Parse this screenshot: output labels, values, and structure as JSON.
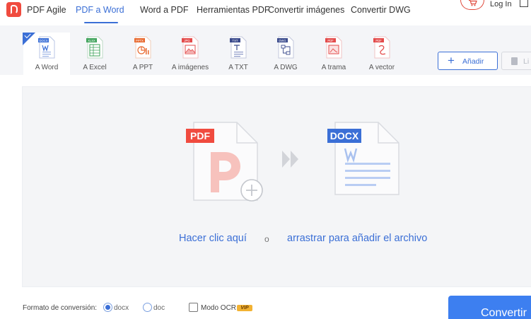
{
  "nav": {
    "items": [
      {
        "label": "PDF Agile",
        "active": false
      },
      {
        "label": "PDF a Word",
        "active": true
      },
      {
        "label": "Word a PDF",
        "active": false
      },
      {
        "label": "Herramientas PDF",
        "active": false
      },
      {
        "label": "Convertir imágenes",
        "active": false
      },
      {
        "label": "Convertir DWG",
        "active": false
      }
    ],
    "login_label": "Log In"
  },
  "tools": [
    {
      "label": "A Word",
      "badge": "DOCX",
      "color": "#3b6fd6",
      "active": true
    },
    {
      "label": "A Excel",
      "badge": "XLSX",
      "color": "#3fa35b",
      "active": false
    },
    {
      "label": "A PPT",
      "badge": "PPTX",
      "color": "#e8692f",
      "active": false
    },
    {
      "label": "A imágenes",
      "badge": "JPG",
      "color": "#e34b4b",
      "active": false
    },
    {
      "label": "A TXT",
      "badge": "TXT",
      "color": "#3a4a8c",
      "active": false
    },
    {
      "label": "A DWG",
      "badge": "DWG",
      "color": "#3a4a8c",
      "active": false
    },
    {
      "label": "A trama",
      "badge": "PDF",
      "color": "#e34b4b",
      "active": false
    },
    {
      "label": "A vector",
      "badge": "PDF",
      "color": "#e34b4b",
      "active": false
    }
  ],
  "actions": {
    "add_label": "Añadir",
    "delete_label": "Li"
  },
  "drop": {
    "source_badge": "PDF",
    "target_badge": "DOCX",
    "click_text": "Hacer clic aquí",
    "or_text": "o",
    "drag_text": "arrastrar para añadir el archivo"
  },
  "options": {
    "format_label": "Formato de conversión:",
    "formats": [
      {
        "label": "docx",
        "selected": true
      },
      {
        "label": "doc",
        "selected": false
      }
    ],
    "ocr_label": "Modo OCR",
    "vip_label": "VIP",
    "convert_label": "Convertir"
  },
  "colors": {
    "accent": "#3b6fd6",
    "brand": "#f04b3f",
    "convert": "#3d7ff0"
  }
}
